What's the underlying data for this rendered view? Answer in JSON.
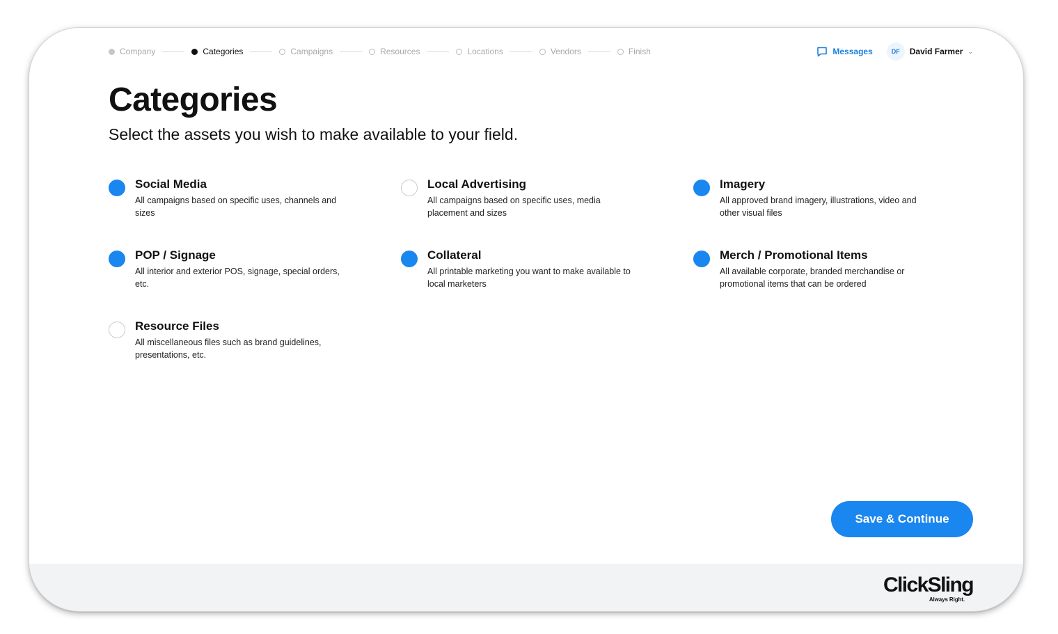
{
  "stepper": {
    "steps": [
      {
        "label": "Company",
        "state": "done"
      },
      {
        "label": "Categories",
        "state": "current"
      },
      {
        "label": "Campaigns",
        "state": "pending"
      },
      {
        "label": "Resources",
        "state": "pending"
      },
      {
        "label": "Locations",
        "state": "pending"
      },
      {
        "label": "Vendors",
        "state": "pending"
      },
      {
        "label": "Finish",
        "state": "pending"
      }
    ]
  },
  "header": {
    "messages_label": "Messages",
    "user": {
      "initials": "DF",
      "name": "David Farmer"
    }
  },
  "page": {
    "title": "Categories",
    "subtitle": "Select the assets you wish to make available to your field."
  },
  "categories": [
    {
      "title": "Social Media",
      "description": "All campaigns based on specific uses, channels and sizes",
      "selected": true
    },
    {
      "title": "Local Advertising",
      "description": "All campaigns based on specific uses, media placement and sizes",
      "selected": false
    },
    {
      "title": "Imagery",
      "description": "All approved brand imagery, illustrations, video and other visual files",
      "selected": true
    },
    {
      "title": "POP / Signage",
      "description": "All interior and exterior POS, signage, special orders, etc.",
      "selected": true
    },
    {
      "title": "Collateral",
      "description": "All printable marketing you want to make available to local marketers",
      "selected": true
    },
    {
      "title": "Merch / Promotional Items",
      "description": "All available corporate, branded merchandise or promotional items that can be ordered",
      "selected": true
    },
    {
      "title": "Resource Files",
      "description": "All miscellaneous files such as brand guidelines, presentations, etc.",
      "selected": false
    }
  ],
  "actions": {
    "save_label": "Save & Continue"
  },
  "footer": {
    "brand": "ClickSling",
    "tagline": "Always Right."
  },
  "colors": {
    "accent": "#1a86f0",
    "link": "#1a7fe0",
    "footer_bg": "#f2f3f5"
  }
}
